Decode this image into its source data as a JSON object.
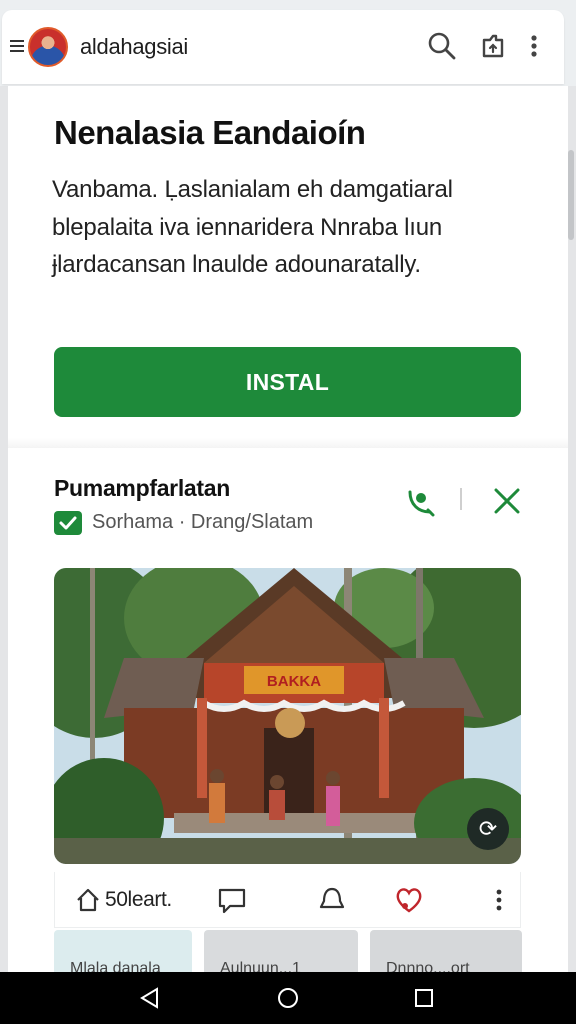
{
  "app": {
    "name": "aldahagsiai"
  },
  "hero": {
    "title": "Nenalasia Eandaioín",
    "body_lines": [
      "Vanbama. Ḷaslanialam eh damgatiaral",
      "blepalaita iva iennaridera Nnraba lıun",
      "ɉlardacansan lnaulde adounaratally."
    ],
    "install_label": "INSTAL"
  },
  "post": {
    "title": "Pumampfarlatan",
    "meta": "Sorhama · Drang/Slatam",
    "photo_banner": "BAKKA",
    "reactions": {
      "like_label": "50leart."
    },
    "thumbnails": [
      "Mlala danala",
      "Aulnuun...1",
      "Dnnno....ort"
    ]
  },
  "icons": {
    "menu": "menu-icon",
    "search": "search-icon",
    "share": "share-box-icon",
    "more": "more-vert-icon",
    "call": "phone-icon",
    "close": "close-icon",
    "home": "home-icon",
    "comment": "comment-icon",
    "bell": "bell-icon",
    "heart": "heart-icon",
    "refresh": "refresh-icon",
    "nav_back": "back-triangle-icon",
    "nav_home": "home-circle-icon",
    "nav_recents": "recents-square-icon"
  },
  "colors": {
    "accent_green": "#1e8a3a",
    "heart_red": "#c0262c"
  }
}
